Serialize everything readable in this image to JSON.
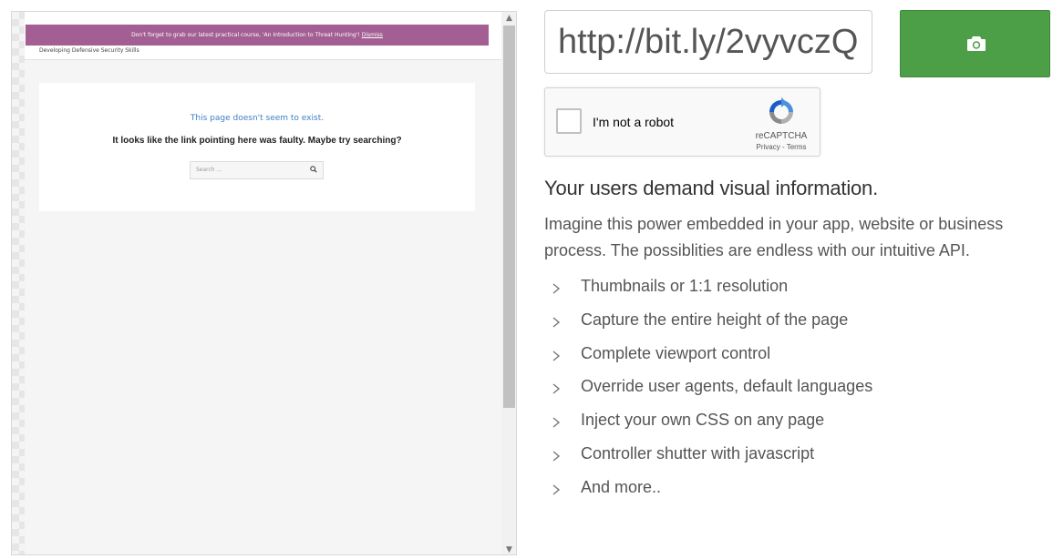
{
  "preview": {
    "notice_text": "Don't forget to grab our latest practical course, 'An Introduction to Threat Hunting'!",
    "notice_link": "Dismiss",
    "site_title": "Developing Defensive Security Skills",
    "card_heading": "This page doesn't seem to exist.",
    "card_subheading": "It looks like the link pointing here was faulty. Maybe try searching?",
    "search_placeholder": "Search ...",
    "accent_color": "#a35f93"
  },
  "form": {
    "url_value": "http://bit.ly/2vyvczQ",
    "capture_icon": "camera-icon",
    "capture_color": "#4c9f46"
  },
  "captcha": {
    "label": "I'm not a robot",
    "brand": "reCAPTCHA",
    "links": "Privacy - Terms",
    "icon": "recaptcha-logo-icon"
  },
  "info": {
    "headline": "Your users demand visual information.",
    "intro": "Imagine this power embedded in your app, website or business process. The possiblities are endless with our intuitive API.",
    "features": [
      "Thumbnails or 1:1 resolution",
      "Capture the entire height of the page",
      "Complete viewport control",
      "Override user agents, default languages",
      "Inject your own CSS on any page",
      "Controller shutter with javascript",
      "And more.."
    ]
  }
}
